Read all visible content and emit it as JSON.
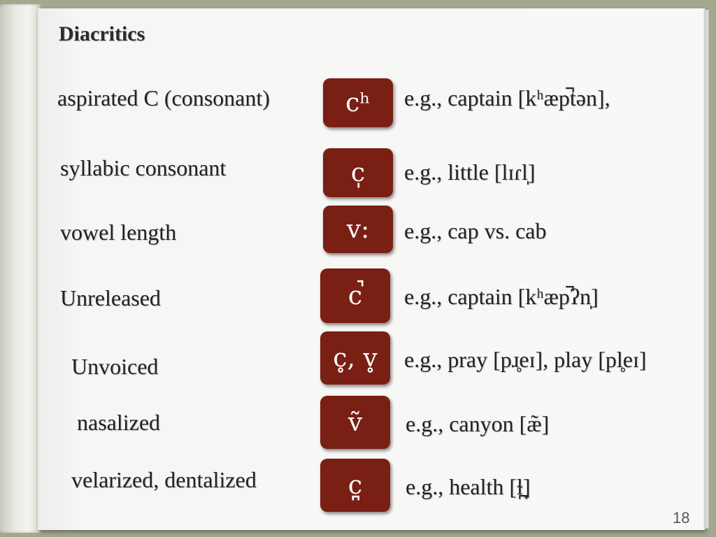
{
  "slide": {
    "title": "Diacritics",
    "page_number": "18",
    "accent_color": "#7a1f14"
  },
  "rows": [
    {
      "label": "aspirated C (consonant)",
      "symbol": "cʰ",
      "example": "e.g., captain [kʰæp̚tən],"
    },
    {
      "label": "syllabic consonant",
      "symbol": "c̩",
      "example": "e.g., little [lɪɾl̩]"
    },
    {
      "label": "vowel length",
      "symbol": "v:",
      "example": "e.g., cap vs. cab"
    },
    {
      "label": "Unreleased",
      "symbol": "c̚",
      "example": "e.g., captain [kʰæp̚ʔn̩]"
    },
    {
      "label": "Unvoiced",
      "symbol": "c̥, v̥",
      "example": "e.g., pray [pɹ̥eɪ], play [pl̥eɪ]"
    },
    {
      "label": "nasalized",
      "symbol": "ṽ",
      "example": "e.g., canyon [æ̃]"
    },
    {
      "label": "velarized, dentalized",
      "symbol": "c̪",
      "example": "e.g., health [ɫ̪]"
    }
  ]
}
